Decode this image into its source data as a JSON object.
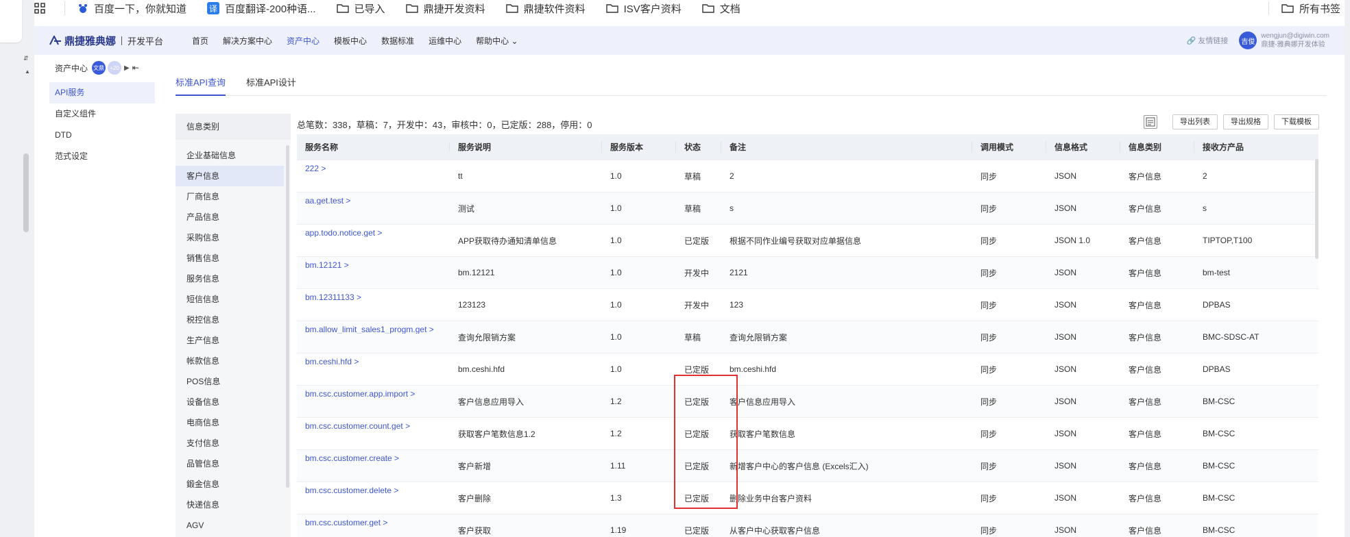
{
  "bookmarks": [
    {
      "label": "百度一下，你就知道",
      "icon": "baidu-icon"
    },
    {
      "label": "百度翻译-200种语...",
      "icon": "translate-icon"
    },
    {
      "label": "已导入",
      "icon": "folder-icon"
    },
    {
      "label": "鼎捷开发资料",
      "icon": "folder-icon"
    },
    {
      "label": "鼎捷软件资料",
      "icon": "folder-icon"
    },
    {
      "label": "ISV客户资料",
      "icon": "folder-icon"
    },
    {
      "label": "文档",
      "icon": "folder-icon"
    }
  ],
  "bookmarks_all": "所有书签",
  "app": {
    "logo": "鼎捷雅典娜",
    "platform": "开发平台",
    "nav": [
      "首页",
      "解决方案中心",
      "资产中心",
      "模板中心",
      "数据标准",
      "运维中心",
      "帮助中心"
    ],
    "active_nav": "资产中心",
    "friend_link": "友情链接",
    "avatar_text": "吉俊",
    "user_email": "wengjun@digiwin.com",
    "user_tenant": "鼎捷-雅典娜开发体验"
  },
  "sidenav": {
    "title": "资产中心",
    "badge1": "文鼎",
    "badge2": "+20",
    "items": [
      "API服务",
      "自定义组件",
      "DTD",
      "范式设定"
    ],
    "active": "API服务"
  },
  "tabs": [
    "标准API查询",
    "标准API设计"
  ],
  "active_tab": "标准API查询",
  "categories": {
    "header": "信息类别",
    "items": [
      "企业基础信息",
      "客户信息",
      "厂商信息",
      "产品信息",
      "采购信息",
      "销售信息",
      "服务信息",
      "短信信息",
      "税控信息",
      "生产信息",
      "帐款信息",
      "POS信息",
      "设备信息",
      "电商信息",
      "支付信息",
      "品管信息",
      "鍛金信息",
      "快递信息",
      "AGV"
    ],
    "active": "客户信息"
  },
  "summary": "总笔数：338，草稿：7，开发中：43，审核中：0，已定版：288，停用：0",
  "actions": [
    "导出列表",
    "导出规格",
    "下载模板"
  ],
  "table": {
    "columns": [
      "服务名称",
      "服务说明",
      "服务版本",
      "状态",
      "备注",
      "调用模式",
      "信息格式",
      "信息类别",
      "接收方产品"
    ],
    "rows": [
      [
        "222 >",
        "tt",
        "1.0",
        "草稿",
        "2",
        "同步",
        "JSON",
        "客户信息",
        "2"
      ],
      [
        "aa.get.test >",
        "测试",
        "1.0",
        "草稿",
        "s",
        "同步",
        "JSON",
        "客户信息",
        "s"
      ],
      [
        "app.todo.notice.get >",
        "APP获取待办通知清单信息",
        "1.0",
        "已定版",
        "根据不同作业编号获取对应单据信息",
        "同步",
        "JSON 1.0",
        "客户信息",
        "TIPTOP,T100"
      ],
      [
        "bm.12121 >",
        "bm.12121",
        "1.0",
        "开发中",
        "2121",
        "同步",
        "JSON",
        "客户信息",
        "bm-test"
      ],
      [
        "bm.12311133 >",
        "123123",
        "1.0",
        "开发中",
        "123",
        "同步",
        "JSON",
        "客户信息",
        "DPBAS"
      ],
      [
        "bm.allow_limit_sales1_progm.get >",
        "查询允限销方案",
        "1.0",
        "草稿",
        "查询允限销方案",
        "同步",
        "JSON",
        "客户信息",
        "BMC-SDSC-AT"
      ],
      [
        "bm.ceshi.hfd >",
        "bm.ceshi.hfd",
        "1.0",
        "已定版",
        "bm.ceshi.hfd",
        "同步",
        "JSON",
        "客户信息",
        "DPBAS"
      ],
      [
        "bm.csc.customer.app.import >",
        "客户信息应用导入",
        "1.2",
        "已定版",
        "客户信息应用导入",
        "同步",
        "JSON",
        "客户信息",
        "BM-CSC"
      ],
      [
        "bm.csc.customer.count.get >",
        "获取客户笔数信息1.2",
        "1.2",
        "已定版",
        "获取客户笔数信息",
        "同步",
        "JSON",
        "客户信息",
        "BM-CSC"
      ],
      [
        "bm.csc.customer.create >",
        "客户新增",
        "1.11",
        "已定版",
        "新增客户中心的客户信息 (Excels汇入)",
        "同步",
        "JSON",
        "客户信息",
        "BM-CSC"
      ],
      [
        "bm.csc.customer.delete >",
        "客户删除",
        "1.3",
        "已定版",
        "删除业务中台客户资料",
        "同步",
        "JSON",
        "客户信息",
        "BM-CSC"
      ],
      [
        "bm.csc.customer.get >",
        "客户获取",
        "1.19",
        "已定版",
        "从客户中心获取客户信息",
        "同步",
        "JSON",
        "客户信息",
        "BM-CSC"
      ]
    ]
  },
  "colors": {
    "accent": "#3d55d4",
    "highlight_box": "#e03030"
  }
}
